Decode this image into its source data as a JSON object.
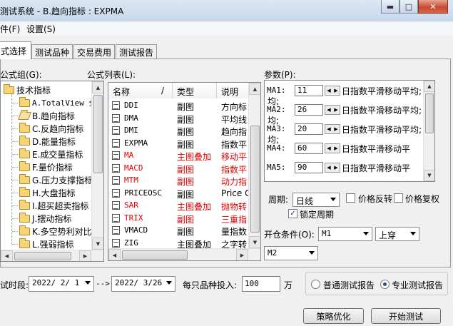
{
  "window": {
    "title": "测试系统 - B.趋向指标 : EXPMA",
    "title_visible": "测试系统 - B.趋向指标 : EXPMA"
  },
  "menu": [
    "件(F)",
    "设置(S)"
  ],
  "tabs": [
    "式选择",
    "测试品种",
    "交易费用",
    "测试报告"
  ],
  "left": {
    "group_label": "公式组(G):",
    "tree": [
      {
        "label": "技术指标",
        "icon": "folder-icon",
        "level": 0
      },
      {
        "label": "A.TotalView 全",
        "icon": "folder-icon",
        "level": 1
      },
      {
        "label": "B.趋向指标",
        "icon": "folder-open-icon",
        "level": 1
      },
      {
        "label": "C.反趋向指标",
        "icon": "folder-icon",
        "level": 1
      },
      {
        "label": "D.能量指标",
        "icon": "folder-icon",
        "level": 1
      },
      {
        "label": "E.成交量指标",
        "icon": "folder-icon",
        "level": 1
      },
      {
        "label": "F.量价指标",
        "icon": "folder-icon",
        "level": 1
      },
      {
        "label": "G.压力支撑指标",
        "icon": "folder-icon",
        "level": 1
      },
      {
        "label": "H.大盘指标",
        "icon": "folder-icon",
        "level": 1
      },
      {
        "label": "I.超买超卖指标",
        "icon": "folder-icon",
        "level": 1
      },
      {
        "label": "J.摆动指标",
        "icon": "folder-icon",
        "level": 1
      },
      {
        "label": "K.多空势利对比",
        "icon": "folder-icon",
        "level": 1
      },
      {
        "label": "L.强弱指标",
        "icon": "folder-icon",
        "level": 1
      }
    ]
  },
  "formula_list": {
    "label": "公式列表(L):",
    "headers": [
      "名称",
      "类型",
      "说明"
    ],
    "sort_indicator": "/",
    "rows": [
      {
        "name": "DDI",
        "type": "副图",
        "desc": "方向标",
        "red": false
      },
      {
        "name": "DMA",
        "type": "副图",
        "desc": "平均线",
        "red": false
      },
      {
        "name": "DMI",
        "type": "副图",
        "desc": "趋向指",
        "red": false
      },
      {
        "name": "EXPMA",
        "type": "副图",
        "desc": "指数平",
        "red": false
      },
      {
        "name": "MA",
        "type": "主图叠加",
        "desc": "移动平",
        "red": true
      },
      {
        "name": "MACD",
        "type": "副图",
        "desc": "指数平",
        "red": true
      },
      {
        "name": "MTM",
        "type": "副图",
        "desc": "动力指",
        "red": true
      },
      {
        "name": "PRICEOSC",
        "type": "副图",
        "desc": "Price O",
        "red": false
      },
      {
        "name": "SAR",
        "type": "主图叠加",
        "desc": "抛物转",
        "red": true
      },
      {
        "name": "TRIX",
        "type": "副图",
        "desc": "三重指",
        "red": true
      },
      {
        "name": "VMACD",
        "type": "副图",
        "desc": "量指数",
        "red": false
      },
      {
        "name": "ZIG",
        "type": "主图叠加",
        "desc": "之字转",
        "red": false
      }
    ]
  },
  "params": {
    "label": "参数(P):",
    "items": [
      {
        "name": "MA1:",
        "value": "11",
        "desc": "日指数平滑移动平均;"
      },
      {
        "name": "MA2:",
        "value": "26",
        "desc": "日指数平滑移动平均;"
      },
      {
        "name": "MA3:",
        "value": "20",
        "desc": "日指数平滑移动平均;"
      },
      {
        "name": "MA4:",
        "value": "60",
        "desc": "日指数平滑移动平"
      },
      {
        "name": "MA5:",
        "value": "90",
        "desc": "日指数平滑移动平"
      }
    ],
    "wrap_text": "均;"
  },
  "period": {
    "label": "周期:",
    "value": "日线",
    "price_reverse": "价格反转",
    "price_restore": "价格复权",
    "lock_period": "锁定周期",
    "lock_checked": true
  },
  "open_condition": {
    "label": "开仓条件(O):",
    "indicator": "M1",
    "cross": "上穿",
    "second": "M2"
  },
  "bottom": {
    "period_label": "试时段:",
    "start_date": "2022/ 2/ 1",
    "arrow": "-->",
    "end_date": "2022/ 3/26",
    "invest_label": "每只品种投入:",
    "invest_value": "100",
    "unit": "万",
    "report_normal": "普通测试报告",
    "report_pro": "专业测试报告",
    "report_selected": "专业测试报告",
    "optimize_button": "策略优化",
    "start_button": "开始测试"
  }
}
